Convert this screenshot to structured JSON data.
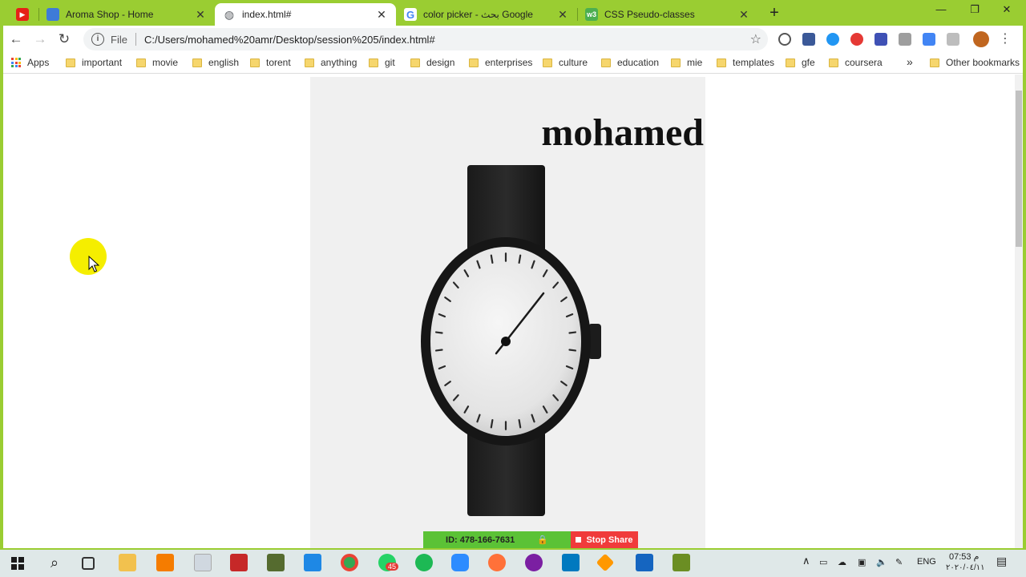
{
  "tabs": [
    {
      "title": "Aroma Shop - Home",
      "favicon": "shop-icon",
      "color": "#3e7bd8"
    },
    {
      "title": "index.html#",
      "favicon": "globe-icon",
      "color": "#5f6368",
      "active": true
    },
    {
      "title": "color picker - بحث Google",
      "favicon": "google-icon",
      "color": "#4285f4"
    },
    {
      "title": "CSS Pseudo-classes",
      "favicon": "w3schools-icon",
      "color": "#4caf50"
    }
  ],
  "toolbar": {
    "scheme": "File",
    "url": "C:/Users/mohamed%20amr/Desktop/session%205/index.html#"
  },
  "bookmarks": {
    "apps": "Apps",
    "items": [
      "important",
      "movie",
      "english",
      "torent",
      "anything",
      "git",
      "design",
      "enterprises",
      "culture",
      "education",
      "mie",
      "templates",
      "gfe",
      "coursera"
    ],
    "overflow": "»",
    "other": "Other bookmarks"
  },
  "page": {
    "heading": "mohamed",
    "image": "wristwatch-image"
  },
  "sharebar": {
    "id_label": "ID: 478-166-7631",
    "stop_label": "Stop Share"
  },
  "taskbar": {
    "lang": "ENG",
    "time": "07:53 م",
    "date": "٢٠٢٠/٠٤/١١",
    "chat_badge": "45"
  },
  "colors": {
    "frame": "#9acd32",
    "highlight": "#f5ee00",
    "share_green": "#5bc236",
    "share_red": "#f03b3b"
  }
}
